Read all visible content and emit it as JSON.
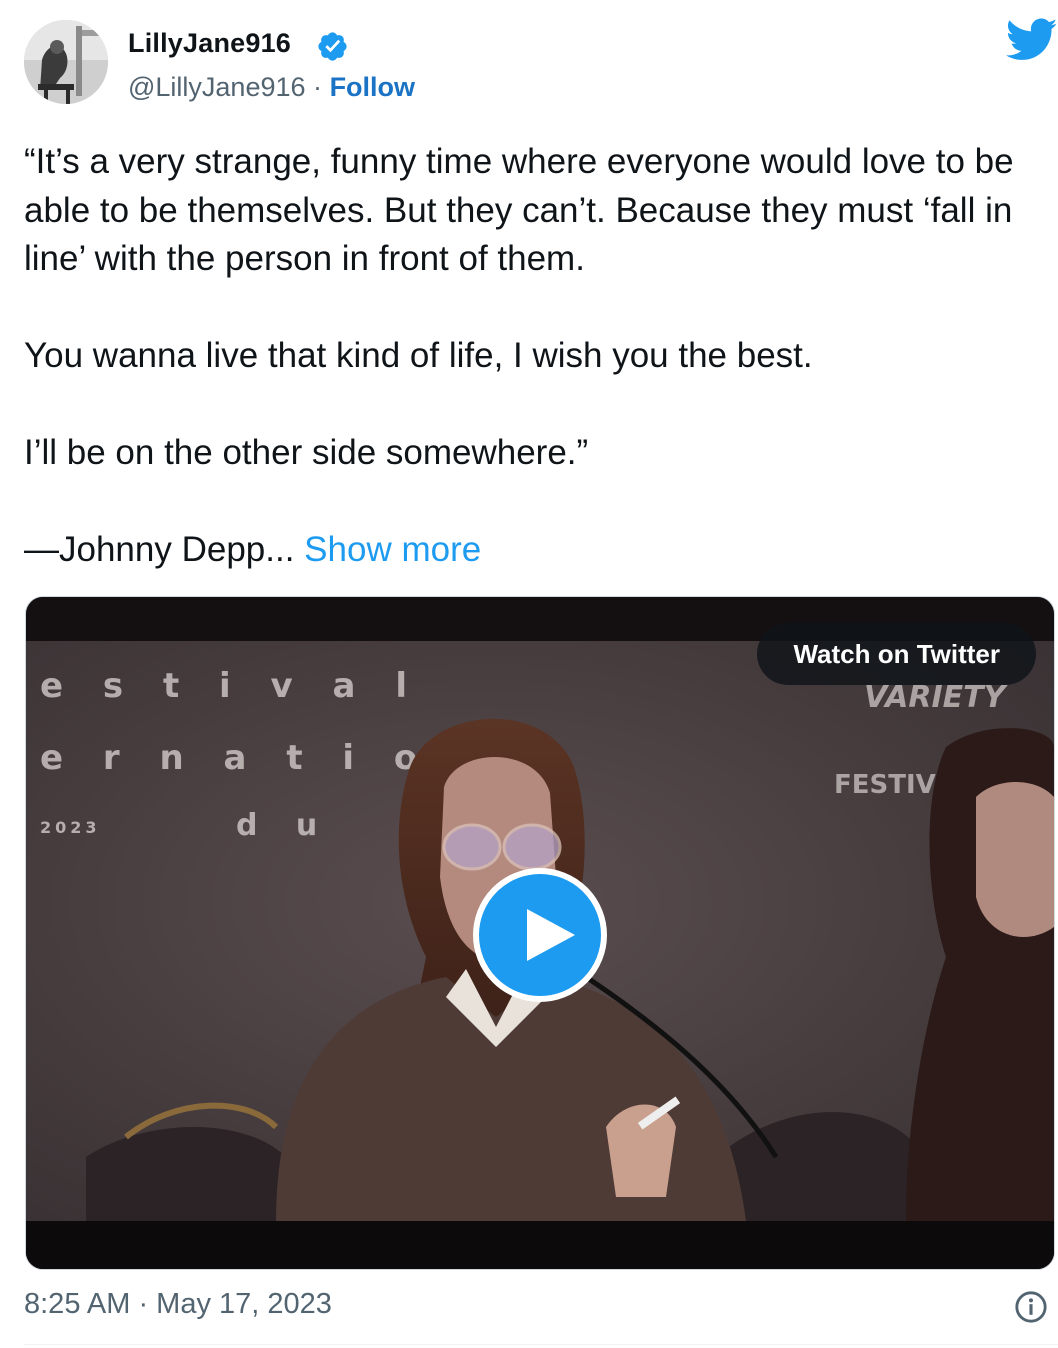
{
  "author": {
    "display_name": "LillyJane916",
    "handle": "@LillyJane916",
    "separator": "·",
    "follow_label": "Follow",
    "verified": true
  },
  "tweet": {
    "paragraphs": [
      "“It’s a very strange, funny time where everyone would love to be able to be themselves. But they can’t. Because they must ‘fall in line’ with the person in front of them.",
      "You wanna live that kind of life, I wish you the best.",
      "I’ll be on the other side somewhere.”",
      "—Johnny Depp..."
    ],
    "show_more_label": "Show more"
  },
  "media": {
    "watch_label": "Watch on Twitter",
    "backdrop_text": {
      "line1": "e s t i v a l",
      "line2": "e r n a t i o",
      "line3": "d u",
      "year": "2023",
      "brand": "VARIETY",
      "festival": "FESTIVAL"
    }
  },
  "footer": {
    "timestamp": "8:25 AM · May 17, 2023"
  },
  "colors": {
    "accent": "#1d9bf0",
    "follow": "#1b73c5",
    "secondary_text": "#536471"
  },
  "icons": [
    "verified-badge-icon",
    "twitter-bird-icon",
    "play-icon",
    "info-icon"
  ]
}
